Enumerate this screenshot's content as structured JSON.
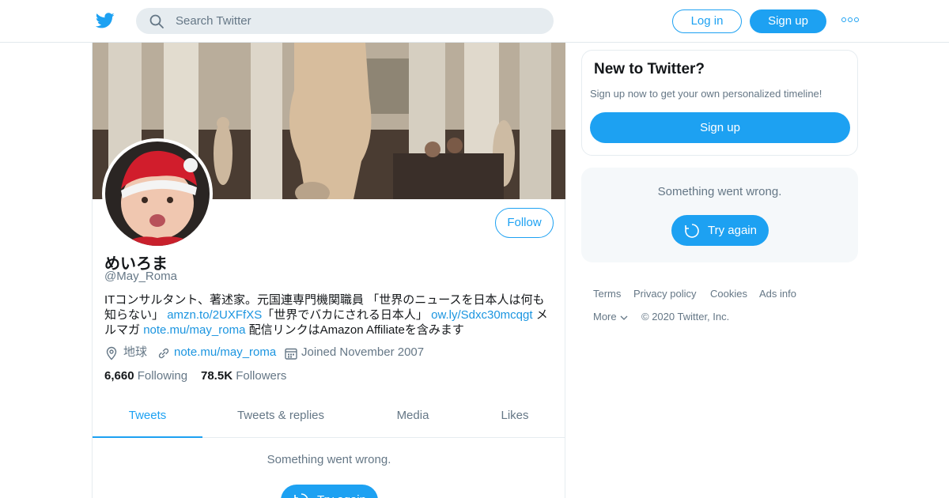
{
  "header": {
    "search_placeholder": "Search Twitter",
    "login_label": "Log in",
    "signup_label": "Sign up"
  },
  "profile": {
    "name": "めいろま",
    "handle": "@May_Roma",
    "follow_label": "Follow",
    "bio": {
      "part1": "ITコンサルタント、著述家。元国連専門機関職員 「世界のニュースを日本人は何も知らない」",
      "link1": "amzn.to/2UXFfXS",
      "part2": "「世界でバカにされる日本人」",
      "link2": "ow.ly/Sdxc30mcqgt",
      "part3": "メルマガ",
      "link3": "note.mu/may_roma",
      "part4": "配信リンクはAmazon Affiliateを含みます"
    },
    "location": "地球",
    "website": "note.mu/may_roma",
    "joined": "Joined November 2007",
    "following_count": "6,660",
    "following_label": "Following",
    "followers_count": "78.5K",
    "followers_label": "Followers"
  },
  "tabs": [
    {
      "label": "Tweets",
      "active": true
    },
    {
      "label": "Tweets & replies",
      "active": false
    },
    {
      "label": "Media",
      "active": false
    },
    {
      "label": "Likes",
      "active": false
    }
  ],
  "timeline": {
    "error_message": "Something went wrong.",
    "retry_label": "Try again"
  },
  "sidebar": {
    "new_title": "New to Twitter?",
    "new_sub": "Sign up now to get your own personalized timeline!",
    "signup_label": "Sign up",
    "error_message": "Something went wrong.",
    "retry_label": "Try again"
  },
  "footer": {
    "terms": "Terms",
    "privacy": "Privacy policy",
    "cookies": "Cookies",
    "ads": "Ads info",
    "more": "More",
    "copyright": "© 2020 Twitter, Inc."
  },
  "colors": {
    "accent": "#1da1f2",
    "link": "#1b95e0",
    "muted": "#657786"
  }
}
